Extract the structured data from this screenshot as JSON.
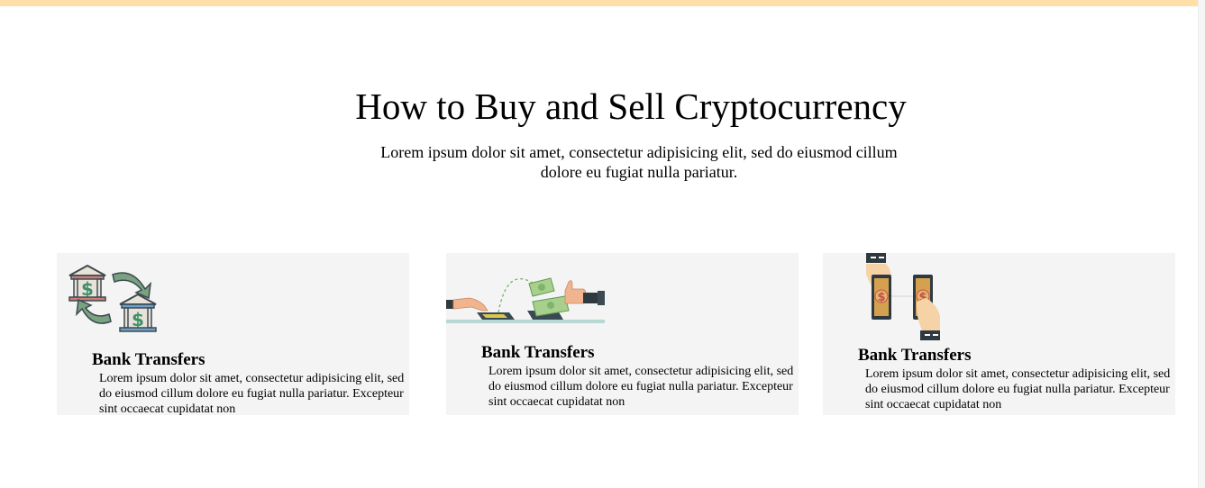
{
  "colors": {
    "top_bar": "#ffdfa8",
    "card_bg": "#f4f4f4",
    "accent_green": "#3f8f6b",
    "bank_outline": "#3c4a52"
  },
  "section": {
    "title": "How to Buy and Sell Cryptocurrency",
    "subtitle": "Lorem ipsum dolor sit amet, consectetur adipisicing elit, sed do eiusmod cillum dolore eu fugiat nulla pariatur."
  },
  "cards": [
    {
      "icon": "bank-exchange-icon",
      "title": "Bank Transfers",
      "text": "Lorem ipsum dolor sit amet, consectetur adipisicing elit, sed do eiusmod cillum dolore eu fugiat nulla pariatur. Excepteur sint occaecat cupidatat non"
    },
    {
      "icon": "mobile-payment-icon",
      "title": "Bank Transfers",
      "text": "Lorem ipsum dolor sit amet, consectetur adipisicing elit, sed do eiusmod cillum dolore eu fugiat nulla pariatur. Excepteur sint occaecat cupidatat non"
    },
    {
      "icon": "phone-transfer-icon",
      "title": "Bank Transfers",
      "text": "Lorem ipsum dolor sit amet, consectetur adipisicing elit, sed do eiusmod cillum dolore eu fugiat nulla pariatur. Excepteur sint occaecat cupidatat non"
    }
  ]
}
